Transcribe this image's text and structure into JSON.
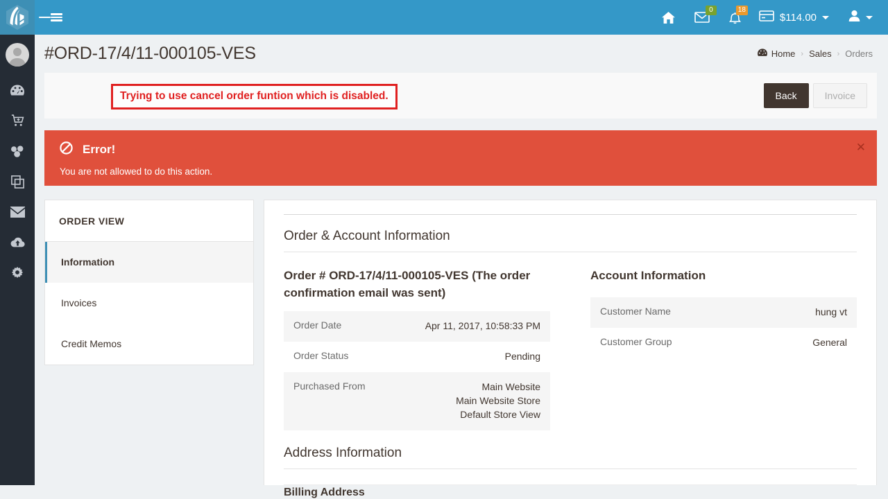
{
  "topbar": {
    "logo_icon": "magento-logo-icon",
    "menu_icon": "hamburger-menu-icon",
    "home_icon": "home-icon",
    "mail_icon": "envelope-icon",
    "mail_badge": "0",
    "bell_icon": "bell-icon",
    "bell_badge": "18",
    "card_icon": "credit-card-icon",
    "amount": "$114.00",
    "user_icon": "user-avatar-icon",
    "accent_color": "#3498c8"
  },
  "leftnav": {
    "avatar_icon": "user-avatar-icon",
    "items": [
      {
        "icon": "dashboard-gauge-icon",
        "name": "dashboard"
      },
      {
        "icon": "shopping-cart-icon",
        "name": "sales"
      },
      {
        "icon": "products-boxes-icon",
        "name": "catalog"
      },
      {
        "icon": "content-pages-icon",
        "name": "content"
      },
      {
        "icon": "envelope-icon",
        "name": "marketing"
      },
      {
        "icon": "cloud-upload-icon",
        "name": "reports"
      },
      {
        "icon": "gear-icon",
        "name": "stores"
      }
    ]
  },
  "page": {
    "title": "#ORD-17/4/11-000105-VES"
  },
  "breadcrumb": {
    "home_icon": "dashboard-gauge-icon",
    "items": [
      "Home",
      "Sales",
      "Orders"
    ],
    "separator": "›"
  },
  "toolbar": {
    "annotation": "Trying to use cancel order funtion which is disabled.",
    "annotation_color": "#e02020",
    "back_label": "Back",
    "invoice_label": "Invoice"
  },
  "alert": {
    "icon": "ban-circle-icon",
    "title": "Error!",
    "message": "You are not allowed to do this action.",
    "close_icon": "close-icon",
    "background": "#e0503c"
  },
  "order_view": {
    "heading": "ORDER VIEW",
    "items": [
      {
        "label": "Information",
        "active": true
      },
      {
        "label": "Invoices",
        "active": false
      },
      {
        "label": "Credit Memos",
        "active": false
      }
    ]
  },
  "main": {
    "section_order_account": "Order & Account Information",
    "order_heading": "Order # ORD-17/4/11-000105-VES (The order confirmation email was sent)",
    "order_table": [
      {
        "label": "Order Date",
        "value": "Apr 11, 2017, 10:58:33 PM"
      },
      {
        "label": "Order Status",
        "value": "Pending"
      },
      {
        "label": "Purchased From",
        "value": "Main Website\nMain Website Store\nDefault Store View"
      }
    ],
    "account_heading": "Account Information",
    "account_table": [
      {
        "label": "Customer Name",
        "value": "hung vt"
      },
      {
        "label": "Customer Group",
        "value": "General"
      }
    ],
    "section_address": "Address Information",
    "billing_heading": "Billing Address"
  }
}
